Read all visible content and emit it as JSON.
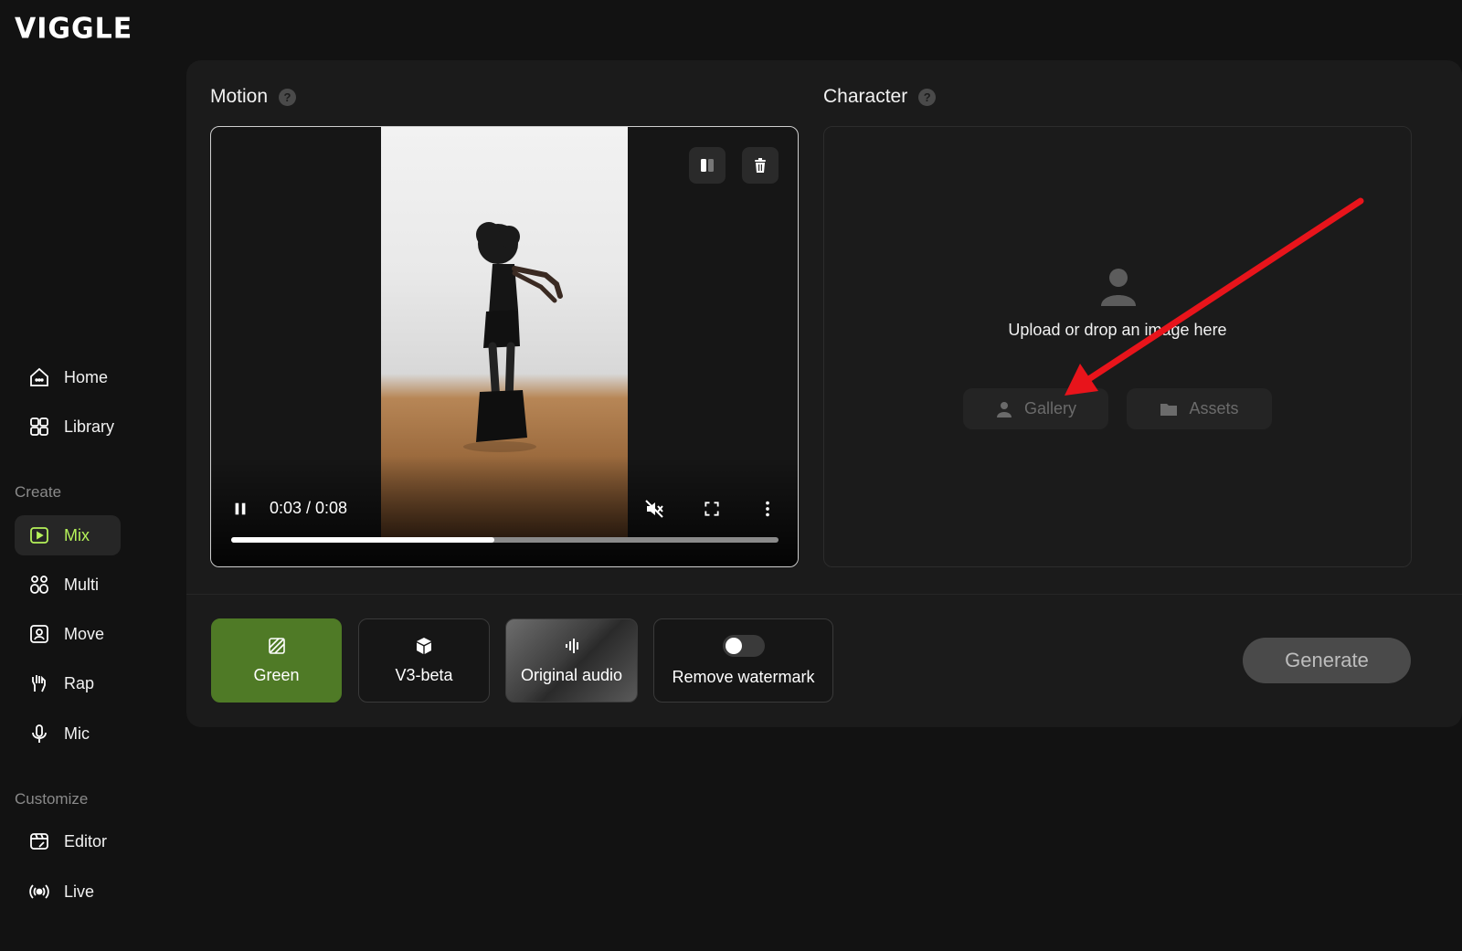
{
  "app": {
    "logo_text": "VIGGLE"
  },
  "sidebar": {
    "main_items": [
      {
        "label": "Home",
        "icon": "home-icon"
      },
      {
        "label": "Library",
        "icon": "library-icon"
      }
    ],
    "create_label": "Create",
    "create_items": [
      {
        "label": "Mix",
        "icon": "mix-icon",
        "active": true
      },
      {
        "label": "Multi",
        "icon": "multi-icon"
      },
      {
        "label": "Move",
        "icon": "move-icon"
      },
      {
        "label": "Rap",
        "icon": "rap-icon"
      },
      {
        "label": "Mic",
        "icon": "mic-icon"
      }
    ],
    "customize_label": "Customize",
    "customize_items": [
      {
        "label": "Editor",
        "icon": "editor-icon"
      },
      {
        "label": "Live",
        "icon": "live-icon"
      }
    ],
    "accent_color": "#b5f25a"
  },
  "motion": {
    "title": "Motion",
    "time_current": "0:03",
    "time_total": "0:08",
    "time_text": "0:03 / 0:08",
    "progress": 0.48
  },
  "character": {
    "title": "Character",
    "upload_text": "Upload or drop an image here",
    "gallery_label": "Gallery",
    "assets_label": "Assets"
  },
  "options": {
    "green_label": "Green",
    "model_label": "V3-beta",
    "audio_label": "Original audio",
    "watermark_label": "Remove watermark",
    "watermark_enabled": false,
    "green_color": "#4f7a26"
  },
  "generate_label": "Generate",
  "annotation": {
    "arrow_color": "#e8141b",
    "points_to": "Gallery"
  }
}
